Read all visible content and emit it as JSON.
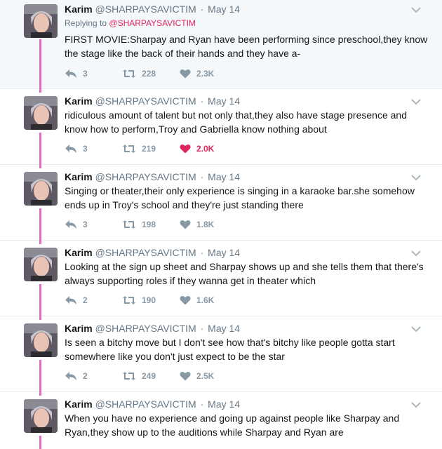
{
  "user": {
    "name": "Karim",
    "handle": "@SHARPAYSAVICTIM",
    "separator": "·"
  },
  "colors": {
    "thread": "#e36bc1",
    "like_active": "#e0245e",
    "action": "#8899a6",
    "highlight_bg": "#f5f8fa"
  },
  "tweets": [
    {
      "date": "May 14",
      "replying_prefix": "Replying to",
      "replying_to": "@SHARPAYSAVICTIM",
      "text": "FIRST MOVIE:Sharpay and Ryan have been performing since preschool,they know the stage like the back of their hands and they have a-",
      "replies": "3",
      "retweets": "228",
      "likes": "2.3K",
      "liked": false
    },
    {
      "date": "May 14",
      "text": "ridiculous amount of talent but not only that,they also have stage presence and know how to perform,Troy and Gabriella know nothing about",
      "replies": "3",
      "retweets": "219",
      "likes": "2.0K",
      "liked": true
    },
    {
      "date": "May 14",
      "text": "Singing or theater,their only experience is singing in a karaoke bar.she somehow ends up in Troy's school and they're just standing there",
      "replies": "3",
      "retweets": "198",
      "likes": "1.8K",
      "liked": false
    },
    {
      "date": "May 14",
      "text": "Looking at the sign up sheet and Sharpay shows up and she tells them that there's always supporting roles if they wanna get in theater which",
      "replies": "2",
      "retweets": "190",
      "likes": "1.6K",
      "liked": false
    },
    {
      "date": "May 14",
      "text": "Is seen a bitchy move but I don't see how that's bitchy like people gotta start somewhere like you don't just expect to be the star",
      "replies": "2",
      "retweets": "249",
      "likes": "2.5K",
      "liked": false
    },
    {
      "date": "May 14",
      "text": "When you have no experience and going up against people like Sharpay and Ryan,they show up to the auditions while Sharpay and Ryan are",
      "replies": "",
      "retweets": "",
      "likes": "",
      "liked": false
    }
  ]
}
